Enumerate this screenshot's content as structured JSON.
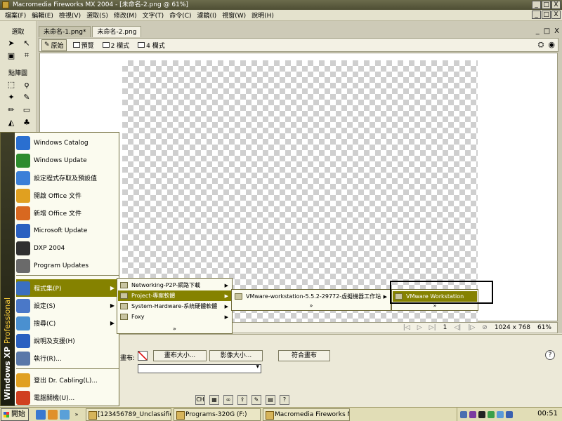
{
  "window": {
    "title": "Macromedia Fireworks MX 2004 - [未命名-2.png @ 61%]",
    "controls": [
      "_",
      "□",
      "X"
    ]
  },
  "menubar": [
    "檔案(F)",
    "編輯(E)",
    "檢視(V)",
    "選取(S)",
    "修改(M)",
    "文字(T)",
    "命令(C)",
    "濾鏡(I)",
    "視窗(W)",
    "說明(H)"
  ],
  "mdi_controls": [
    "_",
    "□",
    "X"
  ],
  "tools": {
    "select_header": "選取",
    "bitmap_header": "點陣圖"
  },
  "document": {
    "tabs": [
      {
        "label": "未命名-1.png*",
        "active": false
      },
      {
        "label": "未命名-2.png",
        "active": true
      }
    ],
    "doc_controls": [
      "_",
      "□",
      "X"
    ],
    "view_buttons": [
      "原始",
      "預覽",
      "2 欄式",
      "4 欄式"
    ],
    "status": {
      "frame": "1",
      "size": "1024 x 768",
      "zoom": "61%"
    }
  },
  "properties": {
    "canvas_label": "畫布:",
    "buttons": [
      "畫布大小...",
      "影像大小...",
      "符合畫布"
    ],
    "help": "?"
  },
  "start_menu": {
    "strip_brand": "Windows XP",
    "strip_edition": "Professional",
    "top_items": [
      {
        "label": "Windows Catalog",
        "color": "#2a6fd0"
      },
      {
        "label": "Windows Update",
        "color": "#2d8c2d"
      },
      {
        "label": "設定程式存取及預設值",
        "color": "#3a7fd8"
      },
      {
        "label": "開啟 Office 文件",
        "color": "#e0a020"
      },
      {
        "label": "新增 Office 文件",
        "color": "#d86820"
      },
      {
        "label": "Microsoft Update",
        "color": "#2a60c0"
      },
      {
        "label": "DXP 2004",
        "color": "#303030"
      },
      {
        "label": "Program Updates",
        "color": "#6a6a6a"
      }
    ],
    "bottom_items": [
      {
        "label": "程式集(P)",
        "arrow": "▶",
        "highlight": true,
        "color": "#3a6fc0"
      },
      {
        "label": "設定(S)",
        "arrow": "▶",
        "highlight": false,
        "color": "#4a78c8"
      },
      {
        "label": "搜尋(C)",
        "arrow": "▶",
        "highlight": false,
        "color": "#4a90d0"
      },
      {
        "label": "說明及支援(H)",
        "arrow": "",
        "highlight": false,
        "color": "#2a60c0"
      },
      {
        "label": "執行(R)...",
        "arrow": "",
        "highlight": false,
        "color": "#5a78a8"
      },
      {
        "label": "登出 Dr. Cabling(L)...",
        "arrow": "",
        "highlight": false,
        "color": "#e0a020"
      },
      {
        "label": "電腦關機(U)...",
        "arrow": "",
        "highlight": false,
        "color": "#d04020"
      }
    ]
  },
  "submenu_programs": {
    "items": [
      {
        "label": "Networking-P2P-網路下載",
        "highlight": false
      },
      {
        "label": "Project-專案軟體",
        "highlight": true
      },
      {
        "label": "System-Hardware-系統硬體軟體",
        "highlight": false
      },
      {
        "label": "Foxy",
        "highlight": false
      }
    ],
    "more": "»"
  },
  "submenu_project": {
    "items": [
      {
        "label": "VMware-workstation-5.5.2-29772-虛擬機器工作站",
        "highlight": false
      }
    ],
    "more": "»"
  },
  "submenu_vmware": {
    "items": [
      {
        "label": "VMware Workstation",
        "highlight": true
      }
    ],
    "more": "»"
  },
  "taskbar": {
    "start_label": "開始",
    "quicklaunch_more": "»",
    "buttons": [
      "[123456789_Unclassified...",
      "Programs-320G (F:)",
      "Macromedia Fireworks M..."
    ],
    "clock": "00:51"
  },
  "colors": {
    "highlight": "#858200",
    "menu_bg": "#fbfbef",
    "taskbar": "#e1ddb6"
  }
}
